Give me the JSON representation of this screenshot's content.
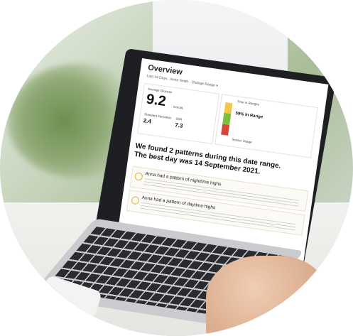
{
  "screen": {
    "title": "Overview",
    "subtitle": "Last 14 Days · Anna Smith · Change Range ▾",
    "avg_label": "Average Glucose",
    "avg_value": "9.2",
    "avg_unit": "mmol/L",
    "sd_label": "Standard Deviation",
    "sd_value": "2.4",
    "gmi_label": "GMI",
    "gmi_value": "7.3",
    "range_label": "Time in Ranges",
    "in_range": "59% In Range",
    "sensor_label": "Sensor Usage",
    "headline_1": "We found 2 patterns during this date range.",
    "headline_2": "The best day was 14 September 2021.",
    "pattern_1": "Anna had a pattern of nighttime highs",
    "pattern_2": "Anna had a pattern of daytime highs"
  },
  "colors": {
    "range_high": "#f2c84b",
    "range_in": "#7bbf3c",
    "range_low": "#d9453a",
    "accent": "#e3b23c"
  }
}
